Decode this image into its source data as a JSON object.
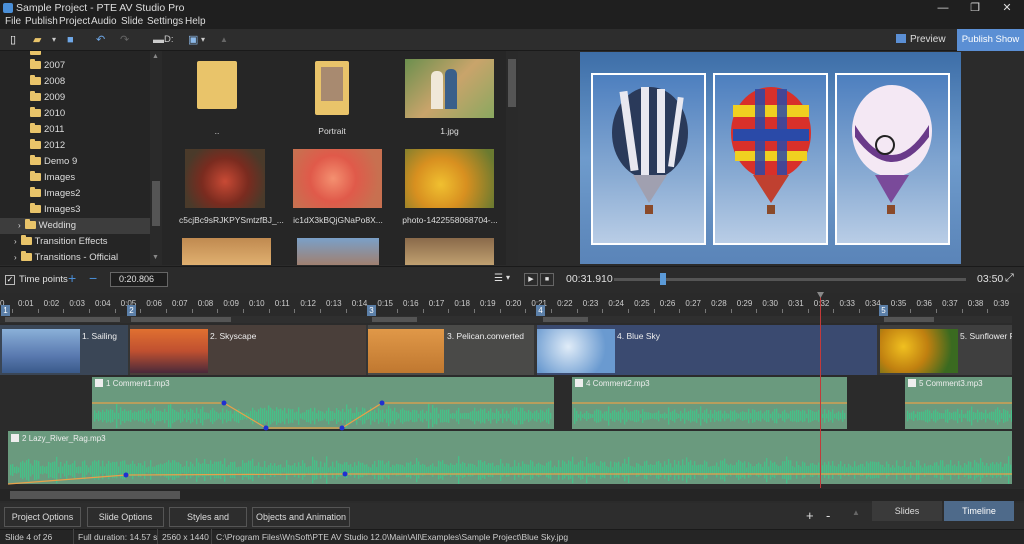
{
  "window": {
    "title": "Sample Project - PTE AV Studio Pro",
    "min": "—",
    "max": "❐",
    "close": "✕"
  },
  "menu": [
    "File",
    "Publish",
    "Project",
    "Audio",
    "Slide",
    "Settings",
    "Help"
  ],
  "toolbar": {
    "drive": "D:",
    "preview_label": "Preview",
    "publish_label": "Publish Show"
  },
  "tree": {
    "items": [
      "2007",
      "2008",
      "2009",
      "2010",
      "2011",
      "2012",
      "Demo 9",
      "Images",
      "Images2",
      "Images3",
      "Wedding",
      "Transition Effects",
      "Transitions - Official"
    ],
    "selected": "Wedding"
  },
  "files": [
    {
      "name": "..",
      "kind": "folder-up"
    },
    {
      "name": "Portrait",
      "kind": "folder"
    },
    {
      "name": "1.jpg",
      "kind": "image"
    },
    {
      "name": "c5cjBc9sRJKPYSmtzfBJ_...",
      "kind": "image"
    },
    {
      "name": "ic1dX3kBQjGNaPo8X...",
      "kind": "image"
    },
    {
      "name": "photo-1422558068704-...",
      "kind": "image"
    }
  ],
  "timepoints": {
    "label": "Time points",
    "checked": true,
    "value": "0:20.806",
    "current_time": "00:31.910",
    "total_time": "03:50",
    "position": 0.14
  },
  "ruler": [
    "0:01",
    "0:02",
    "0:03",
    "0:04",
    "0:05",
    "0:06",
    "0:07",
    "0:08",
    "0:09",
    "0:10",
    "0:11",
    "0:12",
    "0:13",
    "0:14",
    "0:15",
    "0:16",
    "0:17",
    "0:18",
    "0:19",
    "0:20",
    "0:21",
    "0:22",
    "0:23",
    "0:24",
    "0:25",
    "0:26",
    "0:27",
    "0:28",
    "0:29",
    "0:30",
    "0:31",
    "0:32",
    "0:33",
    "0:34",
    "0:35",
    "0:36",
    "0:37",
    "0:38",
    "0:39"
  ],
  "slide_markers": [
    "1",
    "2",
    "3",
    "4",
    "5"
  ],
  "slides": [
    {
      "num": "1.",
      "name": "Sailing"
    },
    {
      "num": "2.",
      "name": "Skyscape"
    },
    {
      "num": "3.",
      "name": "Pelican.converted"
    },
    {
      "num": "4.",
      "name": "Blue Sky"
    },
    {
      "num": "5.",
      "name": "Sunflower Fie"
    }
  ],
  "audio": {
    "clips": [
      {
        "num": "1",
        "name": "Comment1.mp3"
      },
      {
        "num": "4",
        "name": "Comment2.mp3"
      },
      {
        "num": "5",
        "name": "Comment3.mp3"
      }
    ],
    "music": {
      "num": "2",
      "name": "Lazy_River_Rag.mp3"
    }
  },
  "bottom": {
    "buttons": [
      "Project Options",
      "Slide Options",
      "Styles and Themes",
      "Objects and Animation"
    ],
    "plus": "+",
    "minus": "-",
    "tabs": [
      "Slides",
      "Timeline"
    ],
    "active_tab": "Timeline"
  },
  "status": {
    "slide": "Slide 4 of 26",
    "duration": "Full duration: 14.57 s",
    "resolution": "2560 x 1440",
    "path": "C:\\Program Files\\WnSoft\\PTE AV Studio 12.0\\Main\\All\\Examples\\Sample Project\\Blue Sky.jpg"
  },
  "colors": {
    "accent": "#5b8fd4",
    "audio": "#6a9a7e",
    "wave": "#46c088",
    "volume_line": "#e8a04a",
    "playhead": "#c23a3a"
  }
}
